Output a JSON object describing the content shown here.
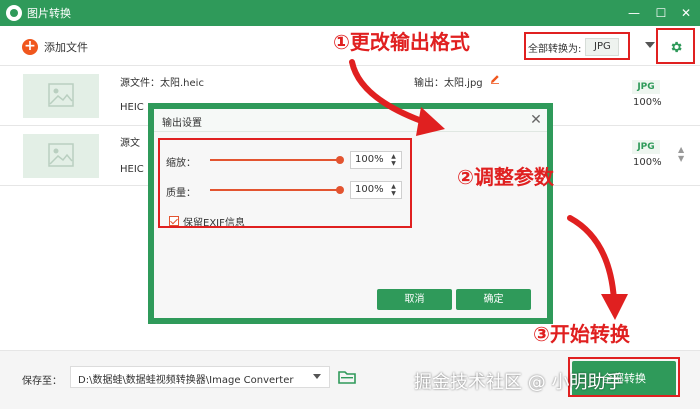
{
  "window": {
    "title": "图片转换"
  },
  "toolbar": {
    "add_label": "添加文件",
    "convert_all_label": "全部转换为:",
    "convert_all_value": "JPG"
  },
  "files": [
    {
      "source": "源文件：太阳.heic",
      "format": "HEIC",
      "output": "输出：太阳.jpg",
      "badge": "JPG",
      "quality": "100%"
    },
    {
      "source": "源文",
      "format": "HEIC",
      "badge": "JPG",
      "quality": "100%"
    }
  ],
  "dialog": {
    "title": "输出设置",
    "scale_label": "缩放：",
    "scale_value": "100%",
    "quality_label": "质量：",
    "quality_value": "100%",
    "scale_level": 1.0,
    "quality_level": 1.0,
    "exif_label": "保留EXIF信息",
    "exif_checked": true,
    "cancel_label": "取消",
    "ok_label": "确定"
  },
  "footer": {
    "save_label": "保存至：",
    "path": "D:\\数据蛙\\数据蛙视频转换器\\Image Converter",
    "start_label": "全部转换"
  },
  "annotations": {
    "step1": "①更改输出格式",
    "step2": "②调整参数",
    "step3": "③开始转换"
  },
  "watermark": "掘金技术社区 @ 小明助手",
  "colors": {
    "brand": "#2f9a5a",
    "accent": "#f0571e",
    "annotation": "#e02020"
  },
  "icons": [
    "logo-icon",
    "minimize-icon",
    "maximize-icon",
    "close-icon",
    "plus-icon",
    "gear-icon",
    "image-icon",
    "pen-icon",
    "folder-icon",
    "checkbox-icon"
  ]
}
